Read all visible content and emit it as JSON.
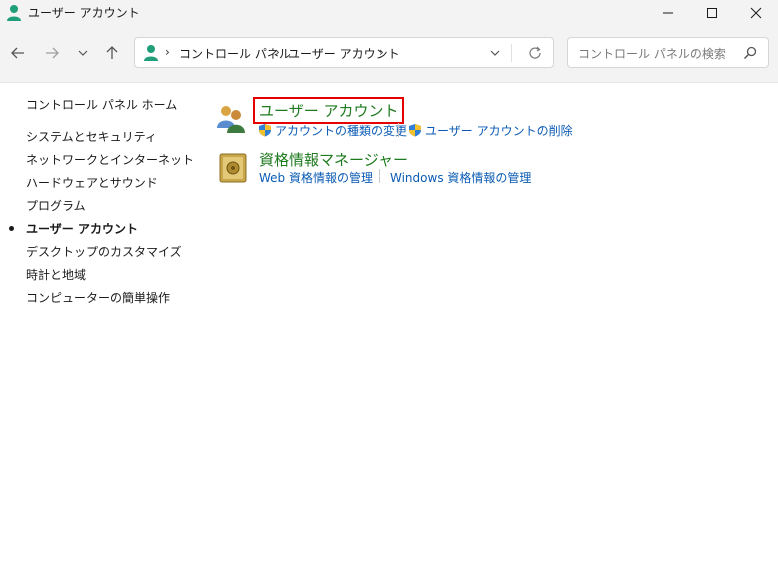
{
  "window": {
    "title": "ユーザー アカウント",
    "icon": "user-accounts-icon"
  },
  "nav": {
    "back_icon": "arrow-left-icon",
    "forward_icon": "arrow-right-icon",
    "recent_icon": "chevron-down-icon",
    "up_icon": "arrow-up-icon"
  },
  "address": {
    "crumbs": [
      "コントロール パネル",
      "ユーザー アカウント"
    ],
    "separator": "›"
  },
  "search": {
    "placeholder": "コントロール パネルの検索"
  },
  "sidebar": {
    "home": "コントロール パネル ホーム",
    "items": [
      "システムとセキュリティ",
      "ネットワークとインターネット",
      "ハードウェアとサウンド",
      "プログラム",
      "ユーザー アカウント",
      "デスクトップのカスタマイズ",
      "時計と地域",
      "コンピューターの簡単操作"
    ],
    "current_index": 4
  },
  "main": {
    "sections": [
      {
        "title": "ユーザー アカウント",
        "icon": "user-accounts-icon",
        "links": [
          "アカウントの種類の変更",
          "ユーザー アカウントの削除"
        ]
      },
      {
        "title": "資格情報マネージャー",
        "icon": "credential-vault-icon",
        "links": [
          "Web 資格情報の管理",
          "Windows 資格情報の管理"
        ]
      }
    ]
  },
  "colors": {
    "link": "#0b5bb5",
    "section_title": "#1e7a1e",
    "highlight_box": "#e60000",
    "chrome_bg": "#f3f3f3"
  }
}
